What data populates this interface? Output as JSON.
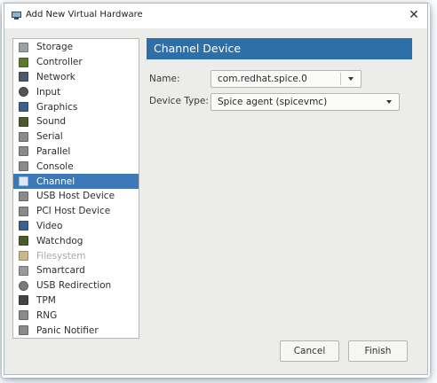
{
  "window": {
    "title": "Add New Virtual Hardware"
  },
  "sidebar": {
    "items": [
      {
        "label": "Storage",
        "icon": "storage-icon",
        "color": "#9aa0a6"
      },
      {
        "label": "Controller",
        "icon": "controller-icon",
        "color": "#5b7a2e"
      },
      {
        "label": "Network",
        "icon": "network-icon",
        "color": "#4a5a6a"
      },
      {
        "label": "Input",
        "icon": "input-icon",
        "color": "#555555"
      },
      {
        "label": "Graphics",
        "icon": "graphics-icon",
        "color": "#3c5f8f"
      },
      {
        "label": "Sound",
        "icon": "sound-icon",
        "color": "#4b5a2e"
      },
      {
        "label": "Serial",
        "icon": "serial-icon",
        "color": "#8a8a8a"
      },
      {
        "label": "Parallel",
        "icon": "parallel-icon",
        "color": "#8a8a8a"
      },
      {
        "label": "Console",
        "icon": "console-icon",
        "color": "#8a8a8a"
      },
      {
        "label": "Channel",
        "icon": "channel-icon",
        "color": "#dfe7f0"
      },
      {
        "label": "USB Host Device",
        "icon": "usb-host-device-icon",
        "color": "#8a8a8a"
      },
      {
        "label": "PCI Host Device",
        "icon": "pci-host-device-icon",
        "color": "#8a8a8a"
      },
      {
        "label": "Video",
        "icon": "video-icon",
        "color": "#3c5f8f"
      },
      {
        "label": "Watchdog",
        "icon": "watchdog-icon",
        "color": "#4b5a2e"
      },
      {
        "label": "Filesystem",
        "icon": "filesystem-icon",
        "color": "#c9b98a"
      },
      {
        "label": "Smartcard",
        "icon": "smartcard-icon",
        "color": "#9a9a9a"
      },
      {
        "label": "USB Redirection",
        "icon": "usb-redirection-icon",
        "color": "#7a7a7a"
      },
      {
        "label": "TPM",
        "icon": "tpm-icon",
        "color": "#444444"
      },
      {
        "label": "RNG",
        "icon": "rng-icon",
        "color": "#8a8a8a"
      },
      {
        "label": "Panic Notifier",
        "icon": "panic-notifier-icon",
        "color": "#8a8a8a"
      }
    ],
    "selected": "Channel",
    "disabled": [
      "Filesystem"
    ]
  },
  "panel": {
    "header": "Channel Device",
    "name_label": "Name:",
    "name_value": "com.redhat.spice.0",
    "device_type_label": "Device Type:",
    "device_type_value": "Spice agent (spicevmc)"
  },
  "buttons": {
    "cancel": "Cancel",
    "finish": "Finish"
  },
  "colors": {
    "accent": "#2e6fa7",
    "selection": "#3d78b8"
  }
}
